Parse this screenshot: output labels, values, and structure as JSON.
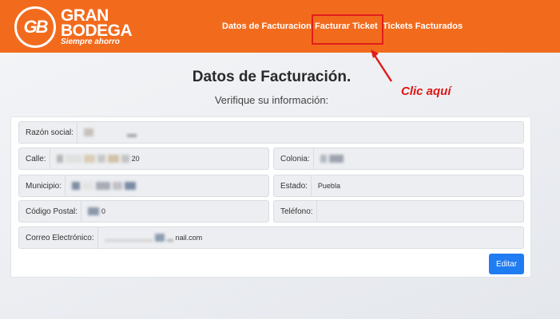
{
  "brand": {
    "monogram": "GB",
    "line1": "GRAN",
    "line2": "BODEGA",
    "tagline": "Siempre ahorro"
  },
  "nav": [
    {
      "label": "Datos de Facturacion"
    },
    {
      "label": "Facturar Ticket"
    },
    {
      "label": "Tickets Facturados"
    }
  ],
  "annotation": {
    "callout": "Clic aquí"
  },
  "page": {
    "title": "Datos de Facturación.",
    "subtitle": "Verifique su información:"
  },
  "form": {
    "razon_social": {
      "label": "Razón social:",
      "value": ""
    },
    "calle": {
      "label": "Calle:",
      "value": "20"
    },
    "colonia": {
      "label": "Colonia:",
      "value": ""
    },
    "municipio": {
      "label": "Municipio:",
      "value": ""
    },
    "estado": {
      "label": "Estado:",
      "value": "Puebla"
    },
    "codigo_postal": {
      "label": "Código Postal:",
      "value": "0"
    },
    "telefono": {
      "label": "Teléfono:",
      "value": ""
    },
    "correo": {
      "label": "Correo Electrónico:",
      "value": "nail.com"
    },
    "edit_label": "Editar"
  },
  "colors": {
    "header": "#f26b1d",
    "highlight": "#e11d1d",
    "primary_button": "#1f7cf1"
  }
}
